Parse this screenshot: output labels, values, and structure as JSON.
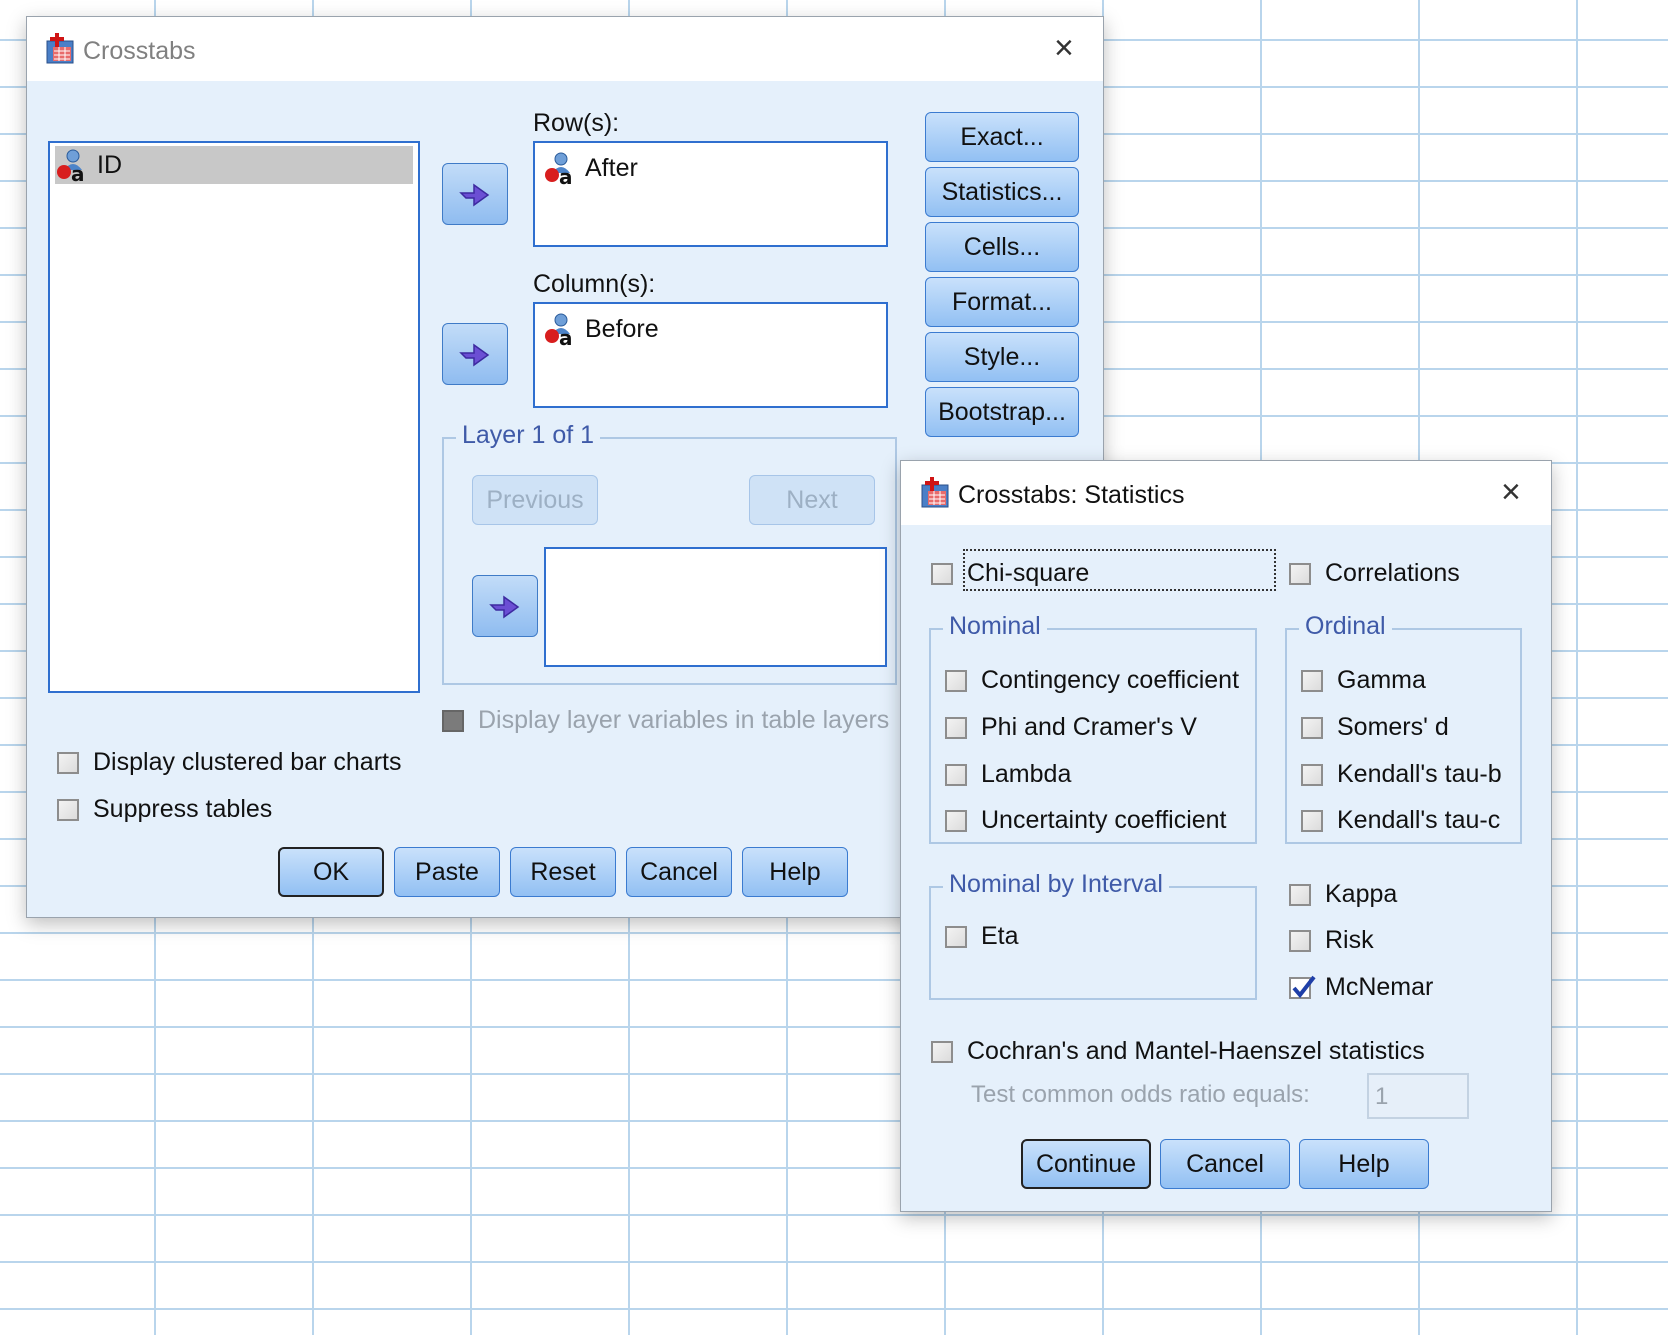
{
  "crosstabs": {
    "title": "Crosstabs",
    "source_list": [
      "ID"
    ],
    "rows_label": "Row(s):",
    "rows": [
      "After"
    ],
    "columns_label": "Column(s):",
    "columns": [
      "Before"
    ],
    "layer_label": "Layer 1 of 1",
    "previous_label": "Previous",
    "next_label": "Next",
    "display_layer_label": "Display layer variables in table layers",
    "clustered_bar_label": "Display clustered bar charts",
    "suppress_tables_label": "Suppress tables",
    "side_buttons": [
      "Exact...",
      "Statistics...",
      "Cells...",
      "Format...",
      "Style...",
      "Bootstrap..."
    ],
    "footer_buttons": [
      "OK",
      "Paste",
      "Reset",
      "Cancel",
      "Help"
    ]
  },
  "statistics": {
    "title": "Crosstabs: Statistics",
    "chi_square_label": "Chi-square",
    "correlations_label": "Correlations",
    "nominal_title": "Nominal",
    "nominal_items": [
      "Contingency coefficient",
      "Phi and Cramer's V",
      "Lambda",
      "Uncertainty coefficient"
    ],
    "ordinal_title": "Ordinal",
    "ordinal_items": [
      "Gamma",
      "Somers' d",
      "Kendall's tau-b",
      "Kendall's tau-c"
    ],
    "nominal_interval_title": "Nominal by Interval",
    "eta_label": "Eta",
    "kappa_label": "Kappa",
    "risk_label": "Risk",
    "mcnemar_label": "McNemar",
    "mcnemar_checked": true,
    "cochran_label": "Cochran's and Mantel-Haenszel statistics",
    "odds_ratio_label": "Test common odds ratio equals:",
    "odds_ratio_value": "1",
    "continue_label": "Continue",
    "cancel_label": "Cancel",
    "help_label": "Help"
  },
  "icons": {
    "app": "crosstabs-app-icon",
    "variable": "nominal-string-variable-icon",
    "move": "move-right-arrow-icon"
  }
}
